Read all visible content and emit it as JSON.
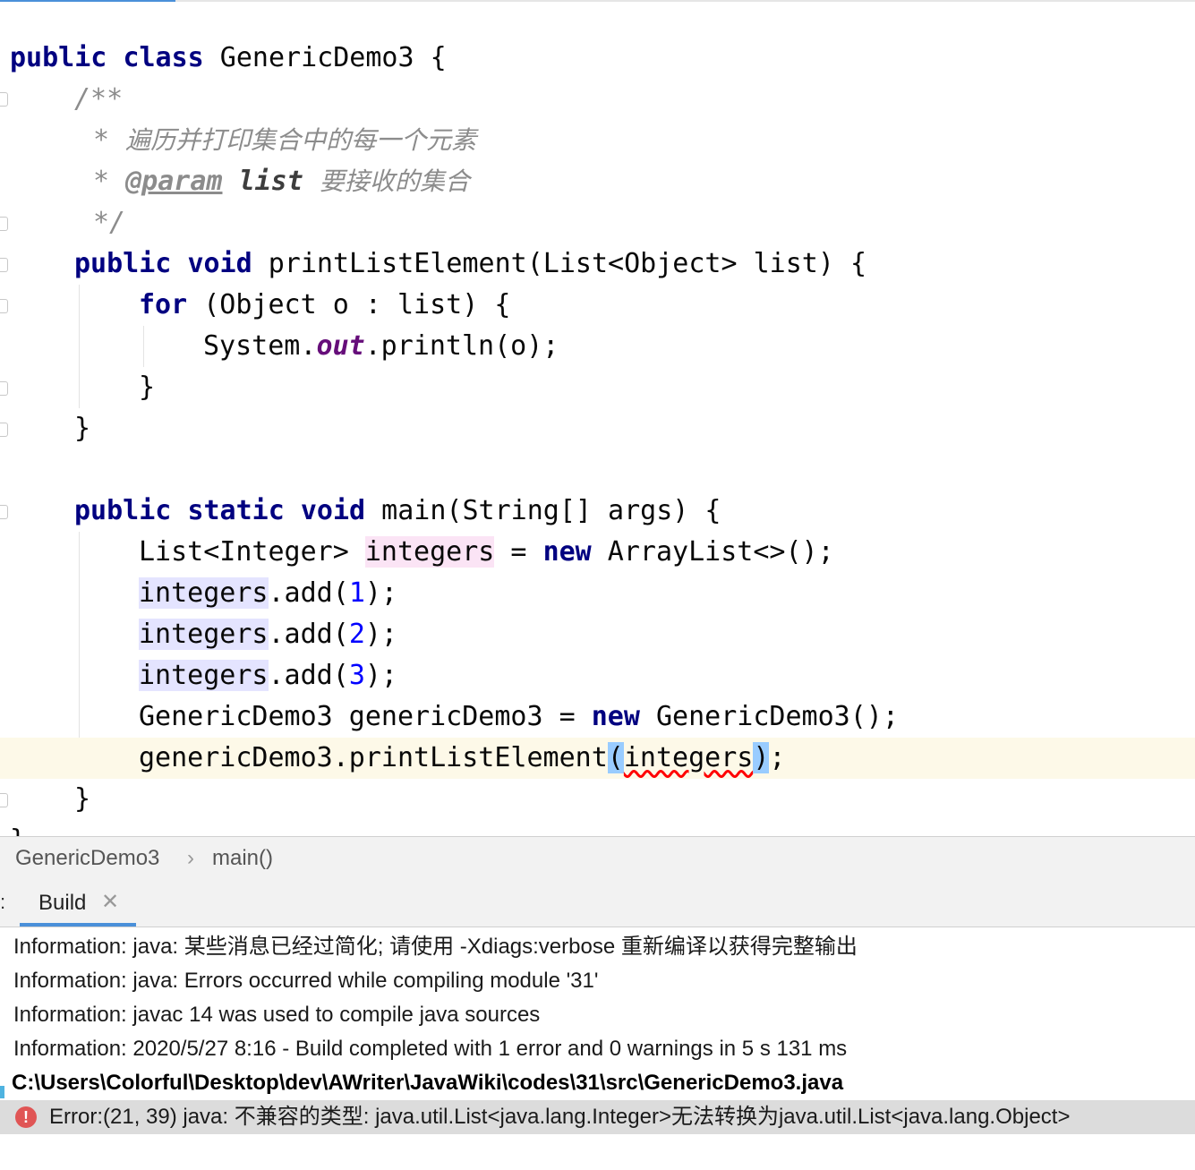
{
  "editor": {
    "lines": {
      "l1": {
        "kw1": "public",
        "kw2": "class",
        "rest": " GenericDemo3 {"
      },
      "l2": {
        "text": "/**"
      },
      "l3": {
        "star": "* ",
        "text": "遍历并打印集合中的每一个元素"
      },
      "l4": {
        "star": "* ",
        "tag": "@param",
        "param": "list",
        "text": "要接收的集合"
      },
      "l5": {
        "text": "*/"
      },
      "l6": {
        "kw1": "public",
        "kw2": "void",
        "rest": " printListElement(List<Object> list) {"
      },
      "l7": {
        "kw": "for",
        "rest": " (Object o : list) {"
      },
      "l8": {
        "a": "System.",
        "field": "out",
        "b": ".println(o);"
      },
      "l9": {
        "text": "}"
      },
      "l10": {
        "text": "}"
      },
      "l11": {
        "kw1": "public",
        "kw2": "static",
        "kw3": "void",
        "rest": " main(String[] args) {"
      },
      "l12": {
        "a": "List<Integer> ",
        "var": "integers",
        "b": " = ",
        "kw": "new",
        "c": " ArrayList<>();"
      },
      "l13": {
        "var": "integers",
        "a": ".add(",
        "num": "1",
        "b": ");"
      },
      "l14": {
        "var": "integers",
        "a": ".add(",
        "num": "2",
        "b": ");"
      },
      "l15": {
        "var": "integers",
        "a": ".add(",
        "num": "3",
        "b": ");"
      },
      "l16": {
        "a": "GenericDemo3 genericDemo3 = ",
        "kw": "new",
        "b": " GenericDemo3();"
      },
      "l17": {
        "a": "genericDemo3.printListElement",
        "p1": "(",
        "arg": "integers",
        "p2": ")",
        "b": ";"
      },
      "l18": {
        "text": "}"
      },
      "l19": {
        "text": "}"
      }
    }
  },
  "breadcrumb": {
    "item1": "GenericDemo3",
    "sep": "›",
    "item2": "main()"
  },
  "tool_window": {
    "tab_label": "Build",
    "close": "✕",
    "side_char": ":"
  },
  "build_output": {
    "lines": [
      "Information: java: 某些消息已经过简化; 请使用 -Xdiags:verbose 重新编译以获得完整输出",
      "Information: java: Errors occurred while compiling module '31'",
      "Information: javac 14 was used to compile java sources",
      "Information: 2020/5/27 8:16 - Build completed with 1 error and 0 warnings in 5 s 131 ms"
    ],
    "file_path": "C:\\Users\\Colorful\\Desktop\\dev\\AWriter\\JavaWiki\\codes\\31\\src\\GenericDemo3.java",
    "error_icon": "!",
    "error_text": "Error:(21, 39)  java: 不兼容的类型: java.util.List<java.lang.Integer>无法转换为java.util.List<java.lang.Object>"
  },
  "colors": {
    "keyword": "#000080",
    "number": "#0000ff",
    "static_field": "#660e7a",
    "comment": "#8c8c8c",
    "current_line": "#fdf9e8",
    "error_icon": "#e05555",
    "accent": "#4a90d9"
  }
}
